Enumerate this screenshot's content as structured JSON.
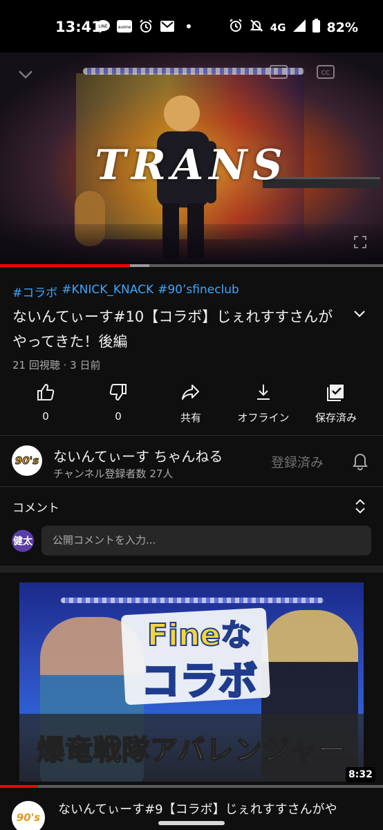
{
  "status_bar": {
    "time": "13:41",
    "left_icons": [
      "line-icon",
      "auone-icon",
      "alarm-icon",
      "gmail-icon",
      "dot-icon"
    ],
    "network": "4G",
    "battery": "82%"
  },
  "player": {
    "overlay_title": "TRANS",
    "progress_fraction": 0.34,
    "buffer_fraction": 0.39
  },
  "video": {
    "hashtags": [
      "#コラボ",
      "#KNICK_KNACK",
      "#90’sfineclub"
    ],
    "title": "ないんてぃーす#10【コラボ】じぇれすすさんがやってきた！後編",
    "meta": "21 回視聴 · 3 日前"
  },
  "actions": {
    "like": "0",
    "dislike": "0",
    "share": "共有",
    "offline": "オフライン",
    "saved": "保存済み"
  },
  "channel": {
    "avatar_text": "90's",
    "name": "ないんてぃーす ちゃんねる",
    "subscribers": "チャンネル登録者数 27人",
    "subscribe_label": "登録済み"
  },
  "comments": {
    "title": "コメント",
    "user_avatar": "健太",
    "placeholder": "公開コメントを入力..."
  },
  "next_video": {
    "thumb_text_1": "Fineな",
    "thumb_text_2": "コラボ",
    "thumb_banner": "爆竜戦隊アバレンジャー",
    "duration": "8:32",
    "title": "ないんてぃーす#9【コラボ】じぇれすすさんがや",
    "avatar_text": "90's",
    "progress_fraction": 0.1
  },
  "colors": {
    "background": "#0f0f0f",
    "hashtag": "#3ea6ff",
    "progress": "#ff0000",
    "muted": "#aaaaaa"
  }
}
